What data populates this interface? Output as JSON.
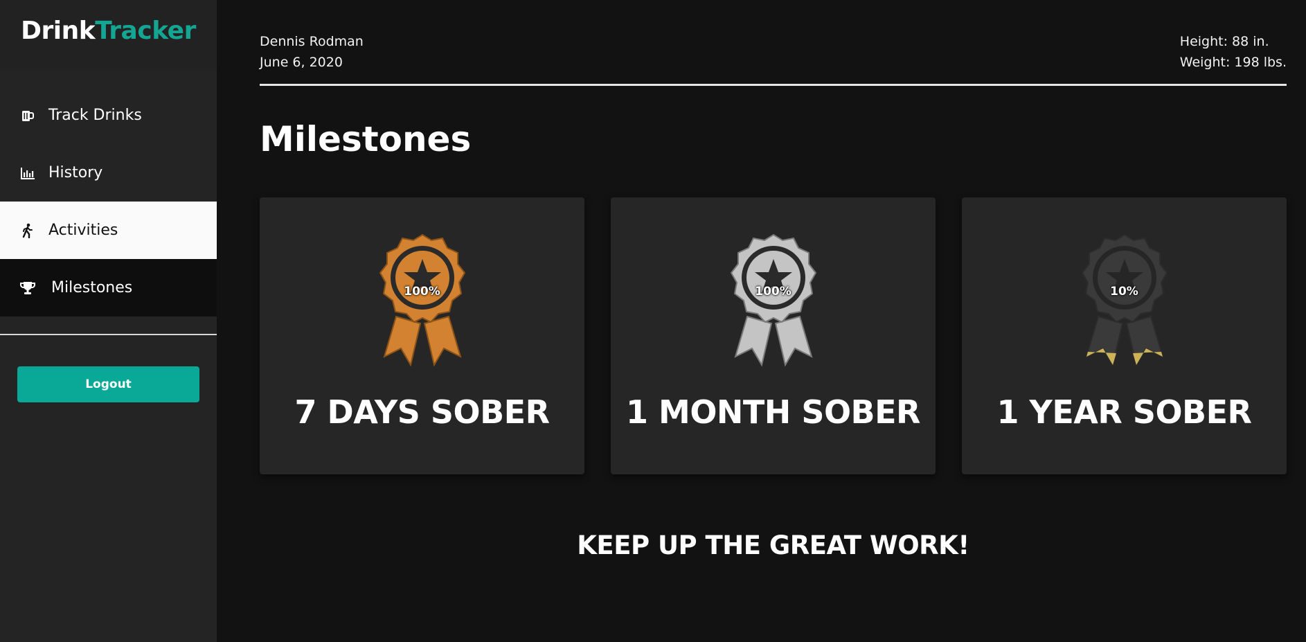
{
  "brand": {
    "part1": "Drink",
    "part2": "Tracker",
    "accent": "#14a593"
  },
  "sidebar": {
    "items": [
      {
        "label": "Track Drinks",
        "icon": "beer-mug-icon"
      },
      {
        "label": "History",
        "icon": "bar-chart-icon"
      },
      {
        "label": "Activities",
        "icon": "walking-person-icon"
      },
      {
        "label": "Milestones",
        "icon": "trophy-icon"
      }
    ],
    "logout_label": "Logout"
  },
  "header": {
    "name": "Dennis Rodman",
    "date": "June 6, 2020",
    "height": "Height: 88 in.",
    "weight": "Weight: 198 lbs."
  },
  "page": {
    "title": "Milestones"
  },
  "milestones": [
    {
      "label": "7 DAYS SOBER",
      "percent": "100%",
      "color": "#d28230",
      "icon": "award-ribbon-icon"
    },
    {
      "label": "1 MONTH SOBER",
      "percent": "100%",
      "color": "#c4c4c4",
      "icon": "award-ribbon-icon"
    },
    {
      "label": "1 YEAR SOBER",
      "percent": "10%",
      "color": "#3a3a3a",
      "progress_fill_color": "#cdb25a",
      "icon": "award-ribbon-icon"
    }
  ],
  "footer": {
    "message": "KEEP UP THE GREAT WORK!"
  }
}
